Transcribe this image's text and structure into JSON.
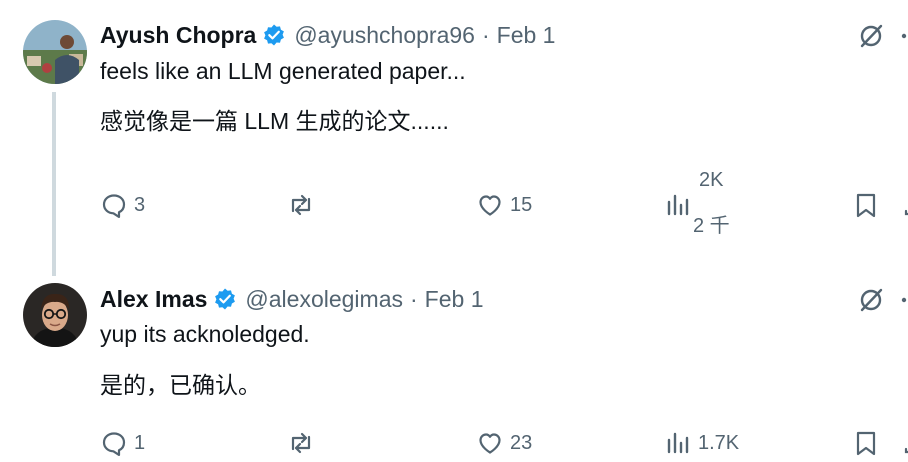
{
  "tweets": [
    {
      "author": "Ayush Chopra",
      "handle": "@ayushchopra96",
      "separator": "·",
      "date": "Feb 1",
      "text": "feels like an LLM generated paper...",
      "translation": "感觉像是一篇 LLM 生成的论文......",
      "replies": "3",
      "likes": "15",
      "views": "2K",
      "views_translated": "2 千"
    },
    {
      "author": "Alex Imas",
      "handle": "@alexolegimas",
      "separator": "·",
      "date": "Feb 1",
      "text": "yup its acknoledged.",
      "translation": "是的，已确认。",
      "replies": "1",
      "likes": "23",
      "views": "1.7K"
    }
  ],
  "colors": {
    "verified": "#1d9bf0",
    "muted": "#536471",
    "text": "#0f1419",
    "thread_line": "#cfd9de"
  }
}
